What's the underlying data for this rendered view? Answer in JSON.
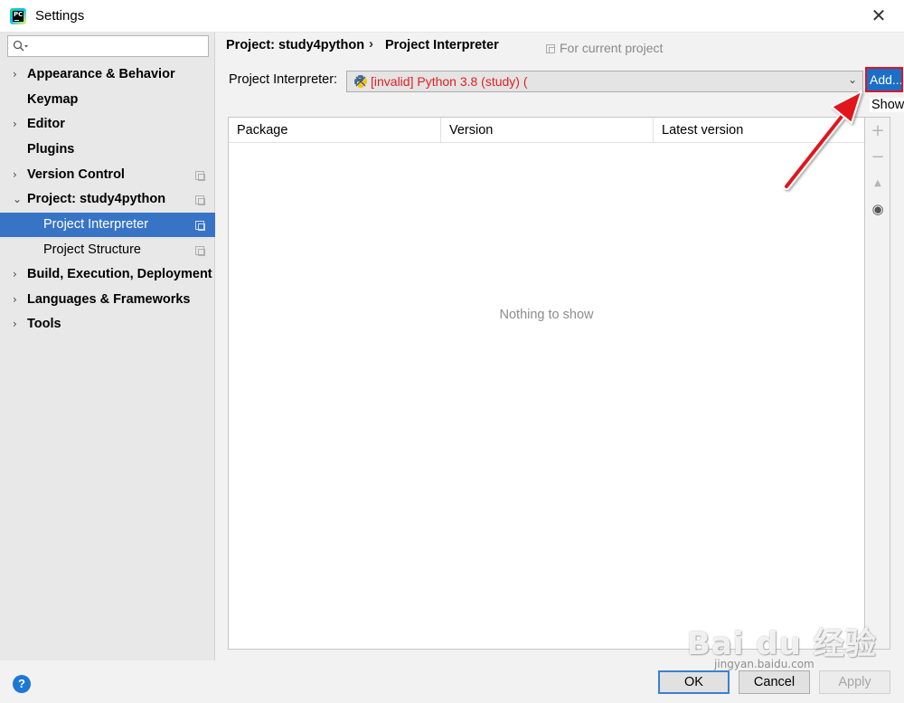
{
  "window": {
    "title": "Settings",
    "close_glyph": "✕"
  },
  "sidebar": {
    "search": {
      "value": "",
      "placeholder": ""
    },
    "items": [
      {
        "label": "Appearance & Behavior",
        "expandable": "›"
      },
      {
        "label": "Keymap"
      },
      {
        "label": "Editor",
        "expandable": "›"
      },
      {
        "label": "Plugins"
      },
      {
        "label": "Version Control",
        "expandable": "›"
      },
      {
        "label": "Project: study4python",
        "expandable": "⌄"
      },
      {
        "label": "Project Interpreter",
        "selected": "true"
      },
      {
        "label": "Project Structure"
      },
      {
        "label": "Build, Execution, Deployment",
        "expandable": "›"
      },
      {
        "label": "Languages & Frameworks",
        "expandable": "›"
      },
      {
        "label": "Tools",
        "expandable": "›"
      }
    ]
  },
  "main": {
    "breadcrumb": {
      "project": "Project: study4python",
      "separator": "›",
      "page": "Project Interpreter"
    },
    "scope_note": "For current project",
    "interpreter": {
      "label": "Project Interpreter:",
      "value": "[invalid] Python 3.8 (study) (",
      "value_color": "#e02020"
    },
    "add_button": "Add...",
    "show_label": "Show",
    "table": {
      "columns": [
        "Package",
        "Version",
        "Latest version"
      ],
      "rows": [],
      "empty_text": "Nothing to show"
    },
    "tools": [
      {
        "icon": "plus-icon",
        "glyph": "+"
      },
      {
        "icon": "minus-icon",
        "glyph": "−"
      },
      {
        "icon": "upgrade-icon",
        "glyph": "▲"
      },
      {
        "icon": "eye-icon",
        "glyph": "◉"
      }
    ]
  },
  "footer": {
    "help": "?",
    "ok": "OK",
    "cancel": "Cancel",
    "apply": "Apply"
  },
  "watermark": {
    "main": "Bai du 经验",
    "sub": "jingyan.baidu.com"
  },
  "colors": {
    "accent": "#3874c5",
    "add_button": "#1a6fc9",
    "annotation": "#e0141e"
  }
}
